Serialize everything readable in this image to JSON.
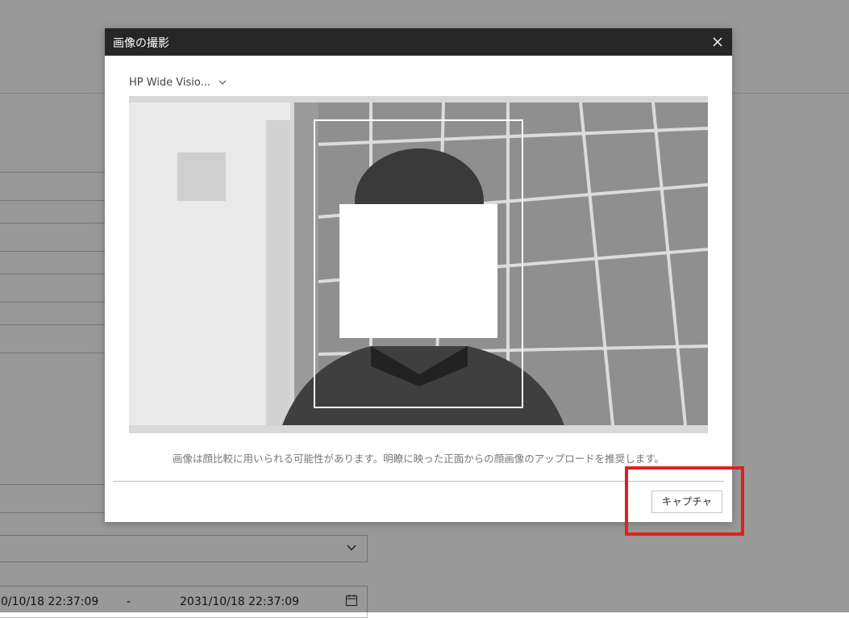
{
  "background_page": {
    "date_range": {
      "start": "0/10/18 22:37:09",
      "separator": "-",
      "end": "2031/10/18 22:37:09"
    }
  },
  "dialog": {
    "title": "画像の撮影",
    "camera": {
      "selected": "HP Wide Visio..."
    },
    "hint": "画像は顔比較に用いられる可能性があります。明瞭に映った正面からの顔画像のアップロードを推奨します。",
    "capture_label": "キャプチャ"
  },
  "colors": {
    "header_bg": "#262626",
    "highlight": "#e02020",
    "overlay": "rgba(0,0,0,0.40)"
  },
  "icons": {
    "close": "close-icon",
    "camera_dropdown": "chevron-down-icon",
    "background_select": "chevron-down-icon",
    "calendar": "calendar-icon"
  }
}
